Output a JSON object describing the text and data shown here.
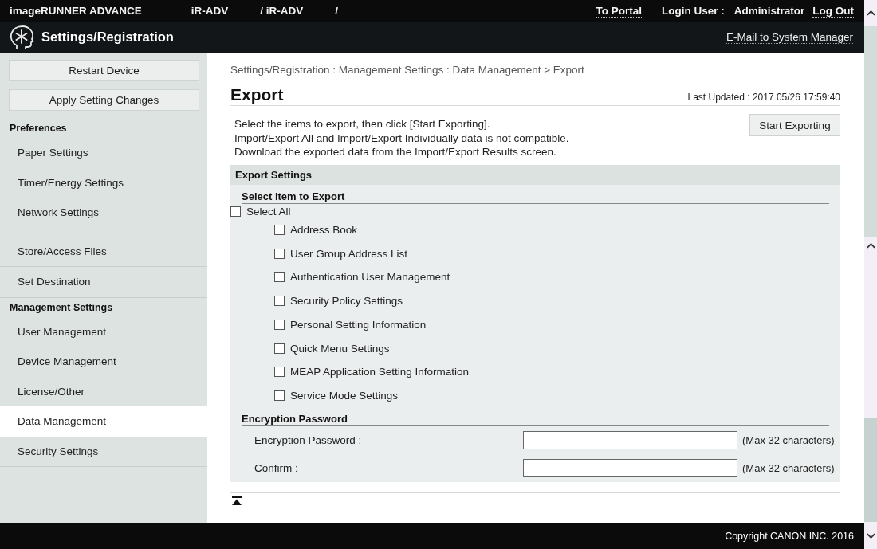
{
  "header": {
    "product": "imageRUNNER ADVANCE",
    "device_fields": [
      "iR-ADV",
      "/ iR-ADV",
      "/"
    ],
    "portal_link": "To Portal",
    "login_label": "Login User :",
    "user": "Administrator",
    "logout_link": "Log Out"
  },
  "title_bar": {
    "title": "Settings/Registration",
    "mail_link": "E-Mail to System Manager"
  },
  "sidebar": {
    "buttons": [
      "Restart Device",
      "Apply Setting Changes"
    ],
    "groups": [
      {
        "title": "Preferences",
        "items": [
          {
            "label": "Paper Settings",
            "selected": false
          },
          {
            "label": "Timer/Energy Settings",
            "selected": false
          },
          {
            "label": "Network Settings",
            "selected": false
          }
        ]
      },
      {
        "items": [
          {
            "label": "Store/Access Files",
            "selected": false
          }
        ]
      },
      {
        "items": [
          {
            "label": "Set Destination",
            "selected": false
          }
        ]
      },
      {
        "title": "Management Settings",
        "items": [
          {
            "label": "User Management",
            "selected": false
          },
          {
            "label": "Device Management",
            "selected": false
          },
          {
            "label": "License/Other",
            "selected": false
          },
          {
            "label": "Data Management",
            "selected": true
          },
          {
            "label": "Security Settings",
            "selected": false
          }
        ]
      }
    ]
  },
  "breadcrumb": "Settings/Registration : Management Settings : Data Management > Export",
  "page": {
    "title": "Export",
    "last_updated": "Last Updated : 2017 05/26 17:59:40",
    "instructions": [
      "Select the items to export, then click [Start Exporting].",
      "Import/Export All and Import/Export Individually data is not compatible.",
      "Download the exported data from the Import/Export Results screen."
    ],
    "start_button": "Start Exporting"
  },
  "export_settings": {
    "title": "Export Settings",
    "select_section": {
      "title": "Select Item to Export",
      "select_all": {
        "label": "Select All",
        "checked": false
      },
      "items": [
        {
          "label": "Address Book",
          "checked": false
        },
        {
          "label": "User Group Address List",
          "checked": false
        },
        {
          "label": "Authentication User Management",
          "checked": false
        },
        {
          "label": "Security Policy Settings",
          "checked": false
        },
        {
          "label": "Personal Setting Information",
          "checked": false
        },
        {
          "label": "Quick Menu Settings",
          "checked": false
        },
        {
          "label": "MEAP Application Setting Information",
          "checked": false
        },
        {
          "label": "Service Mode Settings",
          "checked": false
        }
      ]
    },
    "encryption_section": {
      "title": "Encryption Password",
      "fields": [
        {
          "label": "Encryption Password :",
          "hint": "(Max 32 characters)"
        },
        {
          "label": "Confirm :",
          "hint": "(Max 32 characters)"
        }
      ]
    }
  },
  "footer": {
    "copyright": "Copyright CANON INC. 2016"
  }
}
